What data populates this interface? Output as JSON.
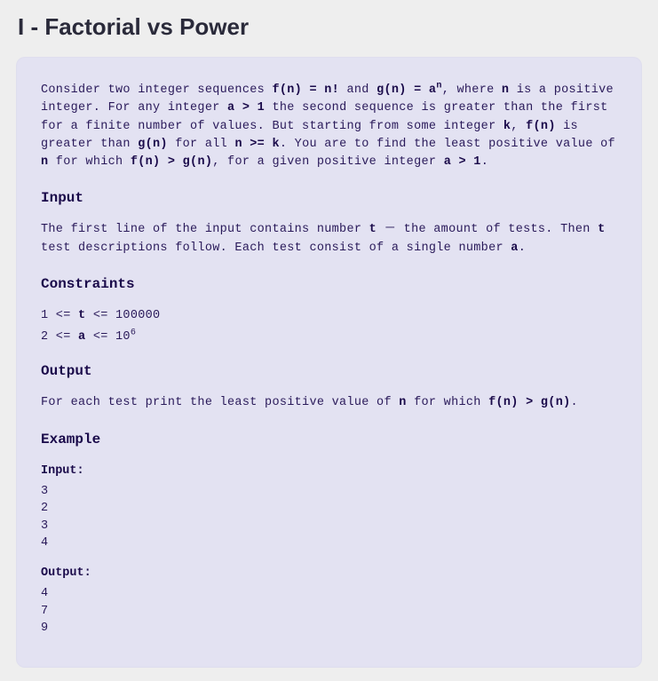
{
  "title": "I - Factorial vs Power",
  "description": {
    "p1_part1": "Consider two integer sequences ",
    "p1_f": "f(n) = n!",
    "p1_part2": " and ",
    "p1_g": "g(n) = a",
    "p1_g_sup": "n",
    "p1_part3": ", where ",
    "p1_n": "n",
    "p1_part4": " is a positive integer. For any integer ",
    "p1_a": "a > 1",
    "p1_part5": " the second sequence is greater than the first for a finite number of values. But starting from some integer ",
    "p1_k": "k",
    "p1_part6": ", ",
    "p1_fn": "f(n)",
    "p1_part7": " is greater than ",
    "p1_gn": "g(n)",
    "p1_part8": " for all ",
    "p1_nk": "n >= k",
    "p1_part9": ". You are to find the least positive value of ",
    "p1_n2": "n",
    "p1_part10": " for which ",
    "p1_fg": "f(n) > g(n)",
    "p1_part11": ", for a given positive integer ",
    "p1_a2": "a > 1",
    "p1_part12": "."
  },
  "headings": {
    "input": "Input",
    "constraints": "Constraints",
    "output": "Output",
    "example": "Example"
  },
  "input": {
    "part1": "The first line of the input contains number ",
    "t": "t",
    "part2": " － the amount of tests. Then ",
    "t2": "t",
    "part3": " test descriptions follow. Each test consist of a single number ",
    "a": "a",
    "part4": "."
  },
  "constraints": {
    "line1_part1": "1 <= ",
    "line1_var": "t",
    "line1_part2": " <= 100000",
    "line2_part1": "2 <= ",
    "line2_var": "a",
    "line2_part2": " <= 10",
    "line2_sup": "6"
  },
  "output": {
    "part1": "For each test print the least positive value of ",
    "n": "n",
    "part2": " for which ",
    "fg": "f(n) > g(n)",
    "part3": "."
  },
  "example": {
    "input_label": "Input:",
    "input_lines": [
      "3",
      "2",
      "3",
      "4"
    ],
    "output_label": "Output:",
    "output_lines": [
      "4",
      "7",
      "9"
    ]
  }
}
